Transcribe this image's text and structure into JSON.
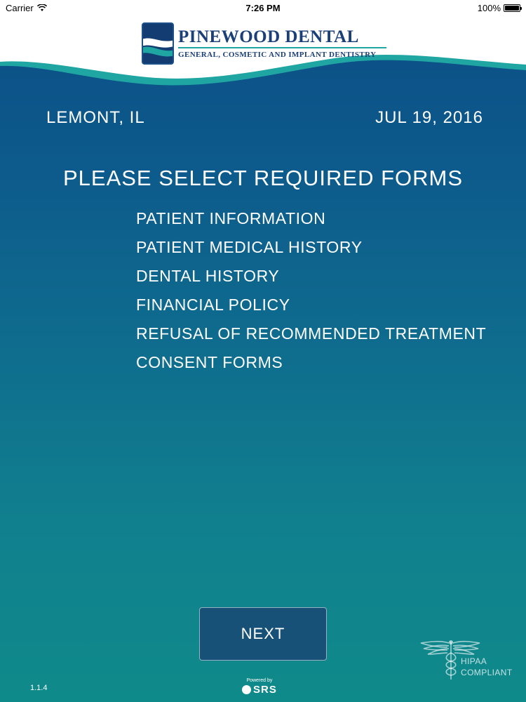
{
  "status_bar": {
    "carrier": "Carrier",
    "time": "7:26 PM",
    "battery": "100%"
  },
  "logo": {
    "title": "PINEWOOD DENTAL",
    "subtitle": "General, Cosmetic and implant dentistry"
  },
  "header": {
    "location": "LEMONT, IL",
    "date": "JUL 19, 2016"
  },
  "forms": {
    "prompt": "PLEASE SELECT REQUIRED FORMS",
    "items": [
      {
        "label": "PATIENT INFORMATION"
      },
      {
        "label": "PATIENT MEDICAL HISTORY"
      },
      {
        "label": "DENTAL HISTORY"
      },
      {
        "label": "FINANCIAL POLICY"
      },
      {
        "label": "REFUSAL OF RECOMMENDED TREATMENT"
      },
      {
        "label": "CONSENT FORMS"
      }
    ]
  },
  "footer": {
    "next_label": "NEXT",
    "version": "1.1.4",
    "powered_label": "Powered by",
    "powered_brand": "SRS",
    "hipaa_line1": "HIPAA",
    "hipaa_line2": "COMPLIANT"
  },
  "colors": {
    "background_top": "#0b4d86",
    "background_bottom": "#0f8a8a",
    "wave_teal": "#1fa6a3",
    "logo_navy": "#1b3f78",
    "button_fill": "#175178"
  }
}
